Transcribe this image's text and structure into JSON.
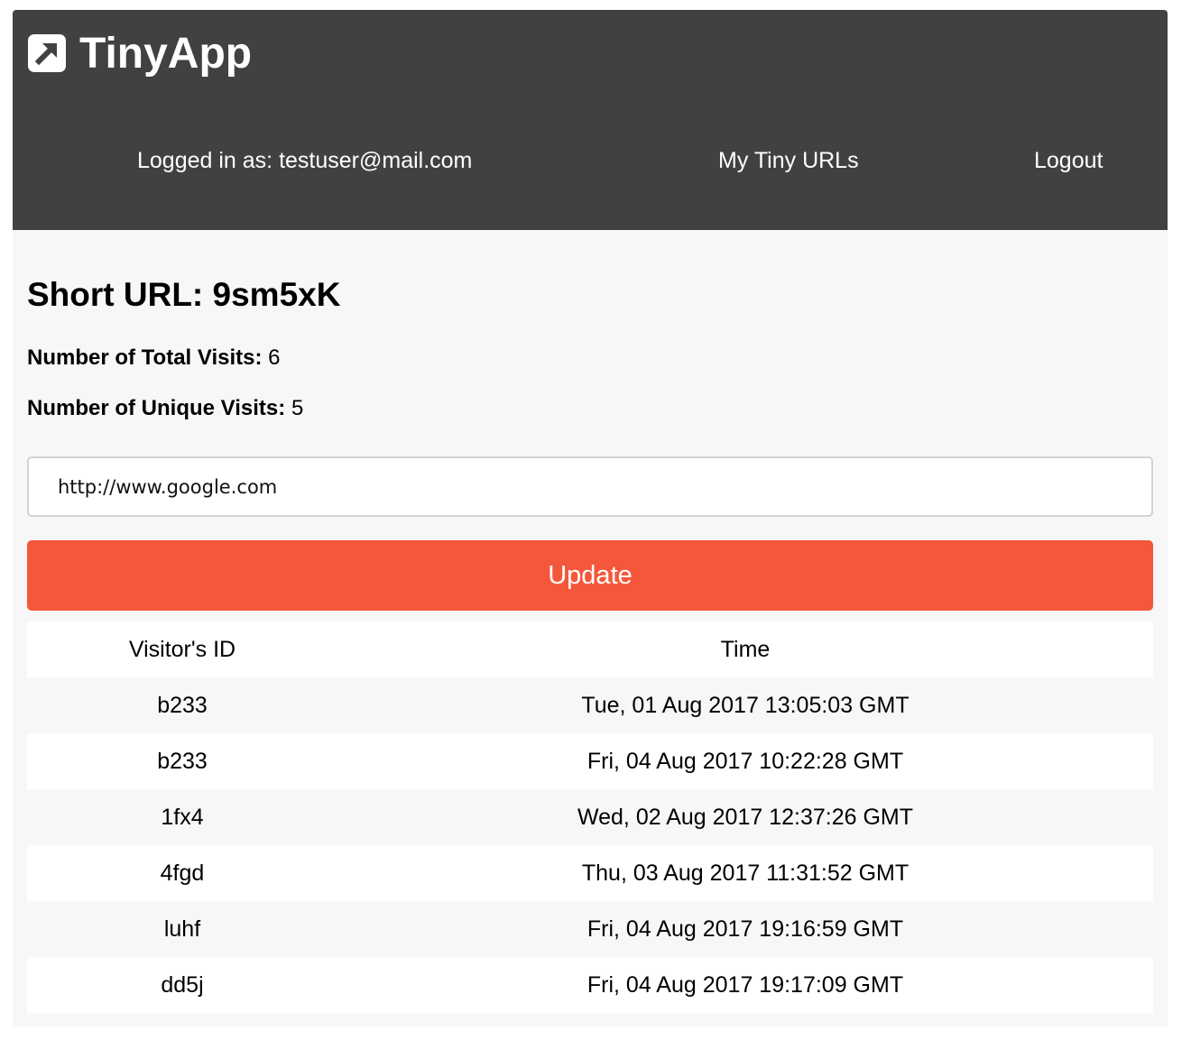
{
  "navbar": {
    "brand": "TinyApp",
    "brand_icon": "external-link-icon",
    "logged_in_text": "Logged in as: testuser@mail.com",
    "my_urls_label": "My Tiny URLs",
    "logout_label": "Logout",
    "background_color": "#414141"
  },
  "main": {
    "title": "Short URL: 9sm5xK",
    "total_visits_label": "Number of Total Visits:",
    "total_visits_value": "6",
    "unique_visits_label": "Number of Unique Visits:",
    "unique_visits_value": "5",
    "long_url_value": "http://www.google.com",
    "update_label": "Update",
    "update_color": "#f4573a"
  },
  "visits_table": {
    "headers": [
      "Visitor's ID",
      "Time"
    ],
    "rows": [
      [
        "b233",
        "Tue, 01 Aug 2017 13:05:03 GMT"
      ],
      [
        "b233",
        "Fri, 04 Aug 2017 10:22:28 GMT"
      ],
      [
        "1fx4",
        "Wed, 02 Aug 2017 12:37:26 GMT"
      ],
      [
        "4fgd",
        "Thu, 03 Aug 2017 11:31:52 GMT"
      ],
      [
        "luhf",
        "Fri, 04 Aug 2017 19:16:59 GMT"
      ],
      [
        "dd5j",
        "Fri, 04 Aug 2017 19:17:09 GMT"
      ]
    ]
  }
}
